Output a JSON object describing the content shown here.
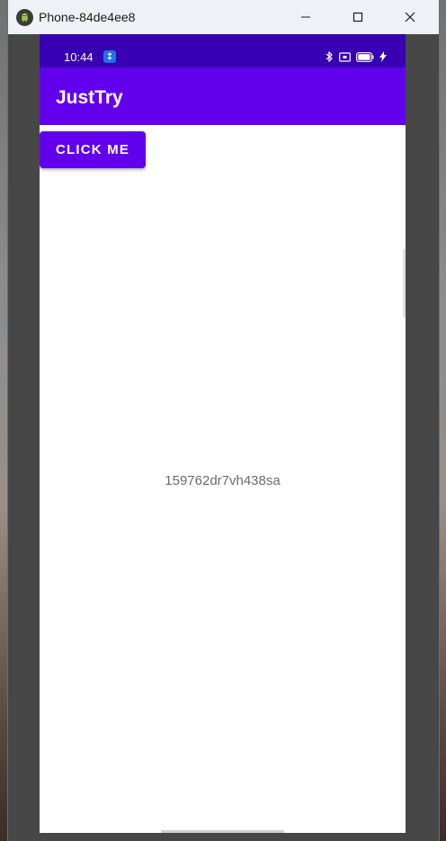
{
  "window": {
    "title": "Phone-84de4ee8",
    "icon": "android-icon",
    "controls": [
      "minimize-icon",
      "maximize-icon",
      "close-icon"
    ]
  },
  "statusbar": {
    "time": "10:44",
    "icons": [
      "notification-icon",
      "bluetooth-icon",
      "cast-icon",
      "battery-icon",
      "charging-icon"
    ]
  },
  "appbar": {
    "title": "JustTry"
  },
  "main": {
    "button_label": "CLICK ME",
    "center_text": "159762dr7vh438sa"
  },
  "colors": {
    "statusbar": "#3700b3",
    "primary": "#6200ee",
    "screen_bg": "#ffffff",
    "text_gray": "#6b6b6b"
  }
}
